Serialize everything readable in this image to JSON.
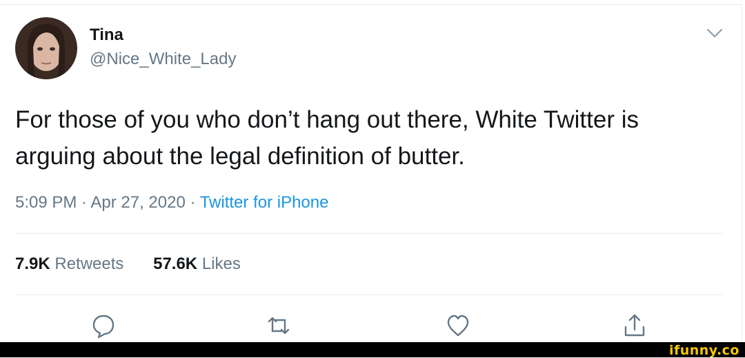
{
  "tweet": {
    "author_name": "Tina",
    "author_handle": "@Nice_White_Lady",
    "text": "For those of you who don’t hang out there, White Twitter is arguing about the legal definition of butter.",
    "timestamp": "5:09 PM · Apr 27, 2020 · ",
    "source": "Twitter for iPhone"
  },
  "stats": {
    "retweets_count": "7.9K",
    "retweets_label": "Retweets",
    "likes_count": "57.6K",
    "likes_label": "Likes"
  },
  "actions": [
    {
      "icon": "reply-icon"
    },
    {
      "icon": "retweet-icon"
    },
    {
      "icon": "like-icon"
    },
    {
      "icon": "share-icon"
    }
  ],
  "watermark": "ifunny.co",
  "colors": {
    "text": "#14171a",
    "secondary": "#657786",
    "link": "#1b95e0",
    "divider": "#e6ecf0",
    "watermark": "#f7c900"
  }
}
